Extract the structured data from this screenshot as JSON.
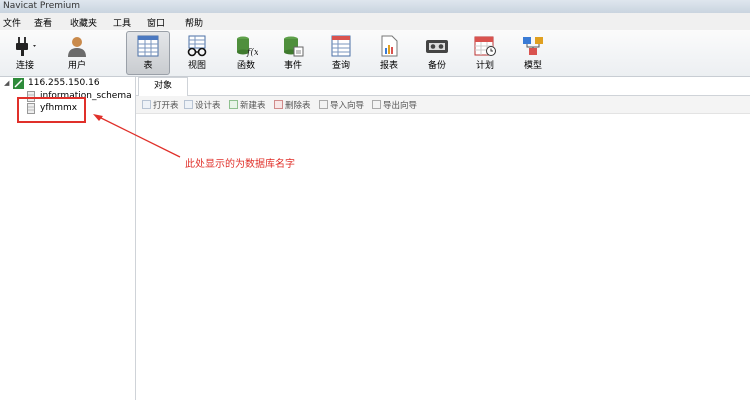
{
  "window": {
    "title": "Navicat Premium"
  },
  "menu": [
    "文件",
    "查看",
    "收藏夹",
    "工具",
    "窗口",
    "帮助"
  ],
  "toolbar": {
    "connect": "连接",
    "user": "用户",
    "table": "表",
    "view": "视图",
    "function": "函数",
    "event": "事件",
    "query": "查询",
    "report": "报表",
    "backup": "备份",
    "schedule": "计划",
    "model": "模型"
  },
  "tree": {
    "connection": "116.255.150.16",
    "databases": [
      "information_schema",
      "yfhmmx"
    ]
  },
  "tabs": {
    "objects": "对象"
  },
  "object_toolbar": {
    "open_table": "打开表",
    "design_table": "设计表",
    "new_table": "新建表",
    "delete_table": "删除表",
    "import_wizard": "导入向导",
    "export_wizard": "导出向导"
  },
  "annotation": {
    "text": "此处显示的为数据库名字",
    "color": "#e0302a"
  }
}
